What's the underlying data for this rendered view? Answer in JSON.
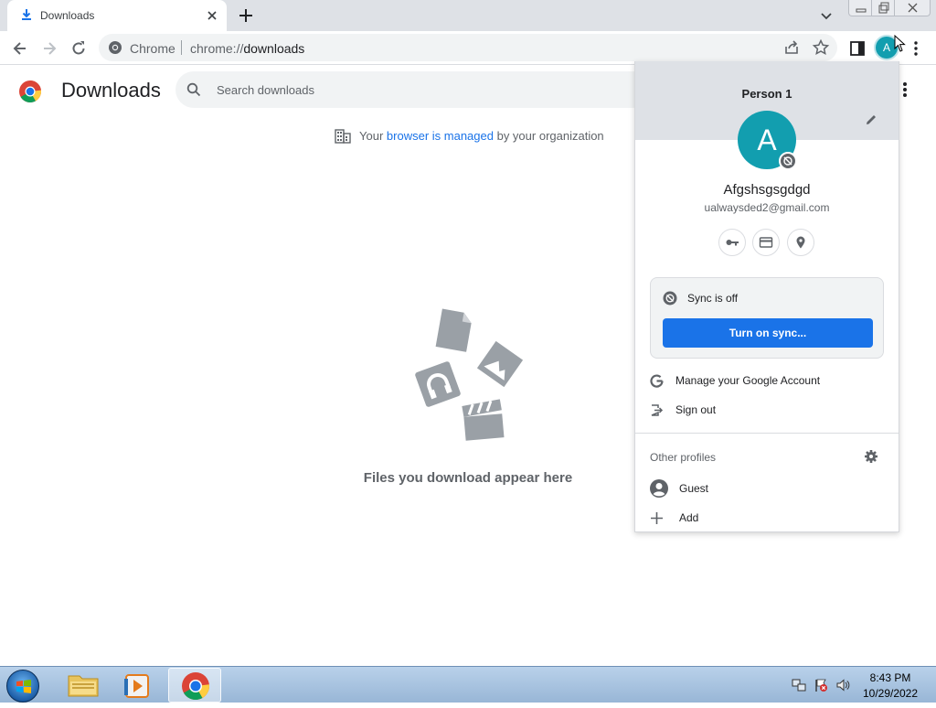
{
  "tab": {
    "title": "Downloads"
  },
  "omnibox": {
    "chip": "Chrome",
    "scheme": "chrome://",
    "host": "downloads"
  },
  "profile_button": {
    "initial": "A"
  },
  "page": {
    "title": "Downloads",
    "search_placeholder": "Search downloads",
    "managed": {
      "prefix": "Your",
      "link": "browser is managed",
      "suffix": "by your organization"
    },
    "empty_text": "Files you download appear here"
  },
  "profile_menu": {
    "profile_name": "Person 1",
    "avatar_initial": "A",
    "account_name": "Afgshsgsgdgd",
    "email": "ualwaysded2@gmail.com",
    "sync_status": "Sync is off",
    "sync_button": "Turn on sync...",
    "manage_account": "Manage your Google Account",
    "sign_out": "Sign out",
    "other_profiles": "Other profiles",
    "guest": "Guest",
    "add": "Add"
  },
  "taskbar": {
    "time": "8:43 PM",
    "date": "10/29/2022"
  },
  "colors": {
    "accent": "#1a73e8",
    "avatar": "#129eaf",
    "tabstrip": "#dee1e6"
  }
}
